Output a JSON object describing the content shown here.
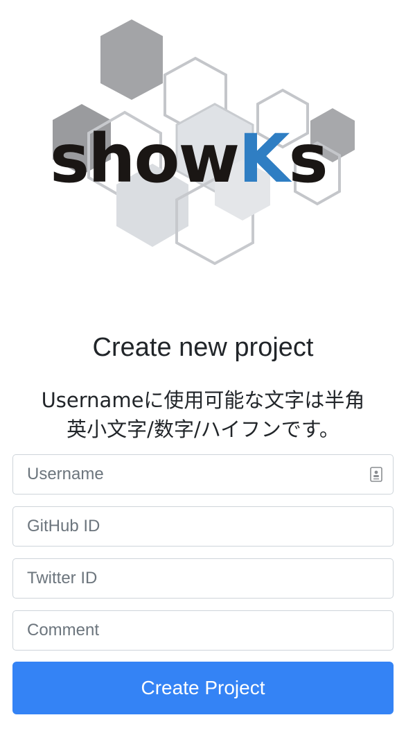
{
  "logo": {
    "text_part1": "show",
    "text_part2": "K",
    "text_part3": "s",
    "accent_color": "#2f7ec3",
    "text_color": "#1a1614"
  },
  "page_title": "Create new project",
  "hint": {
    "line1": "Usernameに使用可能な文字は半角",
    "line2": "英小文字/数字/ハイフンです。"
  },
  "form": {
    "username": {
      "placeholder": "Username",
      "value": ""
    },
    "github": {
      "placeholder": "GitHub ID",
      "value": ""
    },
    "twitter": {
      "placeholder": "Twitter ID",
      "value": ""
    },
    "comment": {
      "placeholder": "Comment",
      "value": ""
    },
    "submit_label": "Create Project"
  },
  "colors": {
    "primary_button": "#3483f5",
    "input_border": "#ced4da"
  },
  "icons": {
    "username_field_icon": "contact-card-icon"
  }
}
